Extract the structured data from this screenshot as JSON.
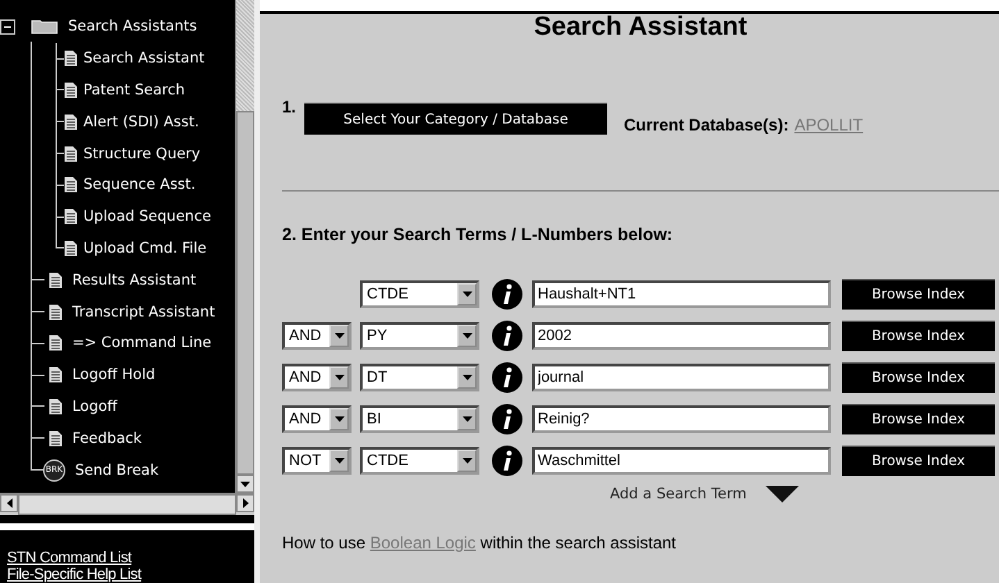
{
  "sidebar": {
    "tree": [
      {
        "label": "Search Assistants",
        "kind": "folder",
        "expanded": true,
        "children": [
          {
            "label": "Search Assistant",
            "kind": "page"
          },
          {
            "label": "Patent Search",
            "kind": "page"
          },
          {
            "label": "Alert (SDI) Asst.",
            "kind": "page"
          },
          {
            "label": "Structure Query",
            "kind": "page"
          },
          {
            "label": "Sequence Asst.",
            "kind": "page"
          },
          {
            "label": "Upload Sequence",
            "kind": "page"
          },
          {
            "label": "Upload Cmd. File",
            "kind": "page"
          }
        ]
      },
      {
        "label": "Results Assistant",
        "kind": "page"
      },
      {
        "label": "Transcript Assistant",
        "kind": "page"
      },
      {
        "label": "=> Command Line",
        "kind": "page"
      },
      {
        "label": "Logoff Hold",
        "kind": "page"
      },
      {
        "label": "Logoff",
        "kind": "page"
      },
      {
        "label": "Feedback",
        "kind": "page"
      },
      {
        "label": "Send Break",
        "kind": "break",
        "badge": "BRK"
      }
    ],
    "links": [
      "STN Command List",
      "File-Specific Help List"
    ]
  },
  "main": {
    "title": "Search Assistant",
    "step1": {
      "number": "1.",
      "button": "Select Your Category / Database",
      "db_label": "Current Database(s):",
      "db_link": "APOLLIT"
    },
    "step2_label": "2. Enter your Search Terms / L-Numbers below:",
    "terms": [
      {
        "field": "CTDE",
        "value": "Haushalt+NT1",
        "button": "Browse Index"
      },
      {
        "operator": "AND",
        "field": "PY",
        "value": "2002",
        "button": "Browse Index"
      },
      {
        "operator": "AND",
        "field": "DT",
        "value": "journal",
        "button": "Browse Index"
      },
      {
        "operator": "AND",
        "field": "BI",
        "value": "Reinig?",
        "button": "Browse Index"
      },
      {
        "operator": "NOT",
        "field": "CTDE",
        "value": "Waschmittel",
        "button": "Browse Index"
      }
    ],
    "add_term": "Add a Search Term",
    "help": {
      "before": "How to use ",
      "link": "Boolean Logic",
      "after": " within the search assistant"
    }
  }
}
